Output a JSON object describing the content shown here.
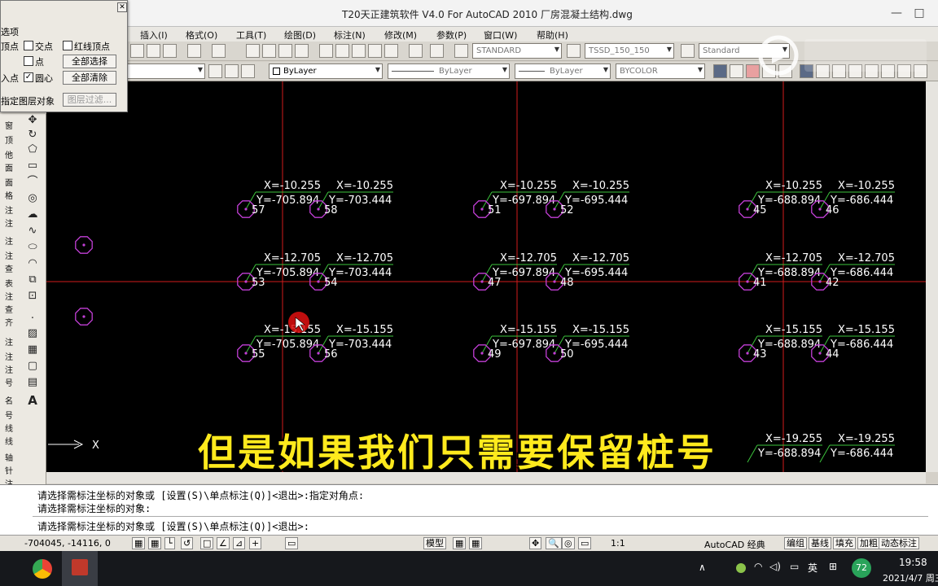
{
  "app": {
    "title": "T20天正建筑软件 V4.0 For AutoCAD 2010     厂房混凝土结构.dwg",
    "window_buttons": [
      "—",
      "□"
    ]
  },
  "menu": [
    {
      "label": "插入(I)"
    },
    {
      "label": "格式(O)"
    },
    {
      "label": "工具(T)"
    },
    {
      "label": "绘图(D)"
    },
    {
      "label": "标注(N)"
    },
    {
      "label": "修改(M)"
    },
    {
      "label": "参数(P)"
    },
    {
      "label": "窗口(W)"
    },
    {
      "label": "帮助(H)"
    }
  ],
  "toolbar": {
    "text_style": "STANDARD",
    "dim_style": "TSSD_150_150",
    "table_style": "Standard",
    "layer_combo": "ByLayer",
    "linetype_combo": "ByLayer",
    "lineweight_combo": "ByLayer",
    "color_combo": "BYCOLOR"
  },
  "snap_dialog": {
    "heading": "选项",
    "row1_left": "顶点",
    "intersect_label": "交点",
    "redline_label": "红线顶点",
    "point_label": "点",
    "select_all": "全部选择",
    "row3_left": "入点",
    "center_label": "圆心",
    "clear_all": "全部清除",
    "layer_label": "指定图层对象",
    "layer_filter": "图层过滤..."
  },
  "palette_labels": [
    "窗",
    "顶",
    "他",
    "面",
    "面",
    "格",
    "注",
    "注",
    "注",
    "注",
    "查",
    "表",
    "注",
    "查",
    "齐",
    "注",
    "注",
    "注",
    "号",
    "名",
    "号",
    "线",
    "线",
    "轴",
    "针",
    "注",
    "层",
    "位"
  ],
  "coordinate_labels": [
    {
      "x": "X=-10.255",
      "y": "Y=-705.894"
    },
    {
      "x": "X=-10.255",
      "y": "Y=-703.444"
    },
    {
      "x": "X=-10.255",
      "y": "Y=-697.894"
    },
    {
      "x": "X=-10.255",
      "y": "Y=-695.444"
    },
    {
      "x": "X=-10.255",
      "y": "Y=-688.894"
    },
    {
      "x": "X=-10.255",
      "y": "Y=-686.444"
    },
    {
      "x": "X=-12.705",
      "y": "Y=-705.894"
    },
    {
      "x": "X=-12.705",
      "y": "Y=-703.444"
    },
    {
      "x": "X=-12.705",
      "y": "Y=-697.894"
    },
    {
      "x": "X=-12.705",
      "y": "Y=-695.444"
    },
    {
      "x": "X=-12.705",
      "y": "Y=-688.894"
    },
    {
      "x": "X=-12.705",
      "y": "Y=-686.444"
    },
    {
      "x": "X=-15.155",
      "y": "Y=-705.894"
    },
    {
      "x": "X=-15.155",
      "y": "Y=-703.444"
    },
    {
      "x": "X=-15.155",
      "y": "Y=-697.894"
    },
    {
      "x": "X=-15.155",
      "y": "Y=-695.444"
    },
    {
      "x": "X=-15.155",
      "y": "Y=-688.894"
    },
    {
      "x": "X=-15.155",
      "y": "Y=-686.444"
    },
    {
      "x": "X=-19.255",
      "y": "Y=-688.894"
    },
    {
      "x": "X=-19.255",
      "y": "Y=-686.444"
    }
  ],
  "pile_numbers": [
    "57",
    "58",
    "51",
    "52",
    "45",
    "46",
    "53",
    "54",
    "47",
    "48",
    "41",
    "42",
    "55",
    "56",
    "49",
    "50",
    "43",
    "44"
  ],
  "subtitle": "但是如果我们只需要保留桩号",
  "command_lines": [
    "请选择需标注坐标的对象或 [设置(S)\\单点标注(Q)]<退出>:指定对角点:",
    "请选择需标注坐标的对象:",
    "请选择需标注坐标的对象或 [设置(S)\\单点标注(Q)]<退出>:"
  ],
  "status": {
    "coords": "-704045, -14116, 0",
    "model": "模型",
    "scale": "1:1",
    "workspace": "AutoCAD 经典",
    "edit": "编组",
    "baseline": "基线",
    "fill": "填充",
    "bold": "加粗",
    "dyn_dim": "动态标注"
  },
  "taskbar": {
    "ime": "英",
    "time": "19:58",
    "date": "2021/4/7 周三",
    "badge": "72"
  },
  "colors": {
    "pile": "#c23fd6",
    "axis": "#d21b1b",
    "leader": "#3cc33c",
    "text": "#ffffff",
    "subtitle": "#ffea1d"
  }
}
